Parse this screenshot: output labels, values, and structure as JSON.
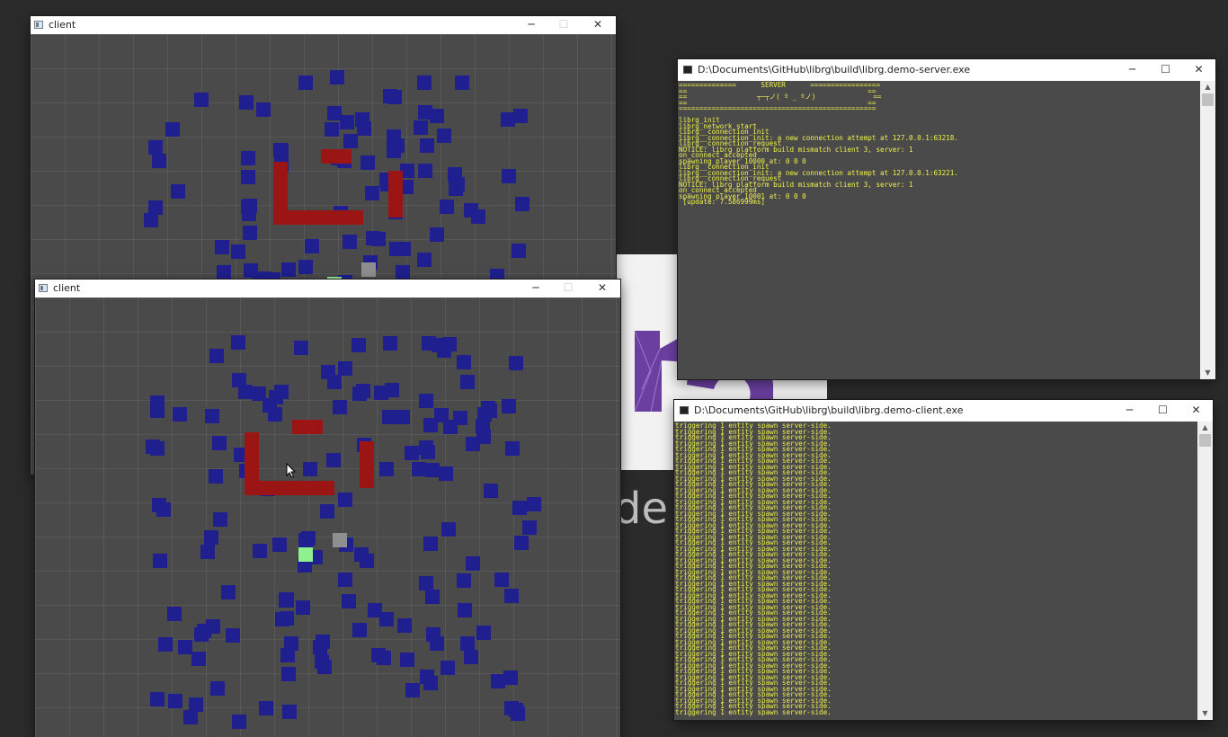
{
  "windows": {
    "client_top": {
      "title": "client"
    },
    "client_bottom": {
      "title": "client"
    },
    "server_console": {
      "title": "D:\\Documents\\GitHub\\librg\\build\\librg.demo-server.exe",
      "lines": [
        "==============      SERVER      =================",
        "==                                            ==",
        "==                 ┬─┬ノ( º _ ºノ)              ==",
        "==                                            ==",
        "================================================",
        "",
        "librg_init",
        "librg_network_start",
        "librg__connection_init",
        "librg__connection_init: a new connection attempt at 127.0.0.1:63218.",
        "librg__connection_request",
        "NOTICE: librg platform build mismatch client 3, server: 1",
        "on_connect_accepted",
        "spawning player 10000 at: 0 0 0",
        "librg__connection_init",
        "librg__connection_init: a new connection attempt at 127.0.0.1:63221.",
        "librg__connection_request",
        "NOTICE: librg platform build mismatch client 3, server: 1",
        "on_connect_accepted",
        "spawning player 10001 at: 0 0 0",
        " [update: 7.586999ms]"
      ]
    },
    "client_console": {
      "title": "D:\\Documents\\GitHub\\librg\\build\\librg.demo-client.exe",
      "line_text": "triggering 1 entity spawn server-side.",
      "line_count": 50
    }
  },
  "window_controls": {
    "minimize": "─",
    "maximize": "☐",
    "close": "✕"
  },
  "background": {
    "partial_text": "de"
  },
  "colors": {
    "entity": "#1f1f8f",
    "wall": "#9b1515",
    "player": "#8ff08f",
    "other_player": "#8f8f8f",
    "console_text": "#f1f14a"
  }
}
